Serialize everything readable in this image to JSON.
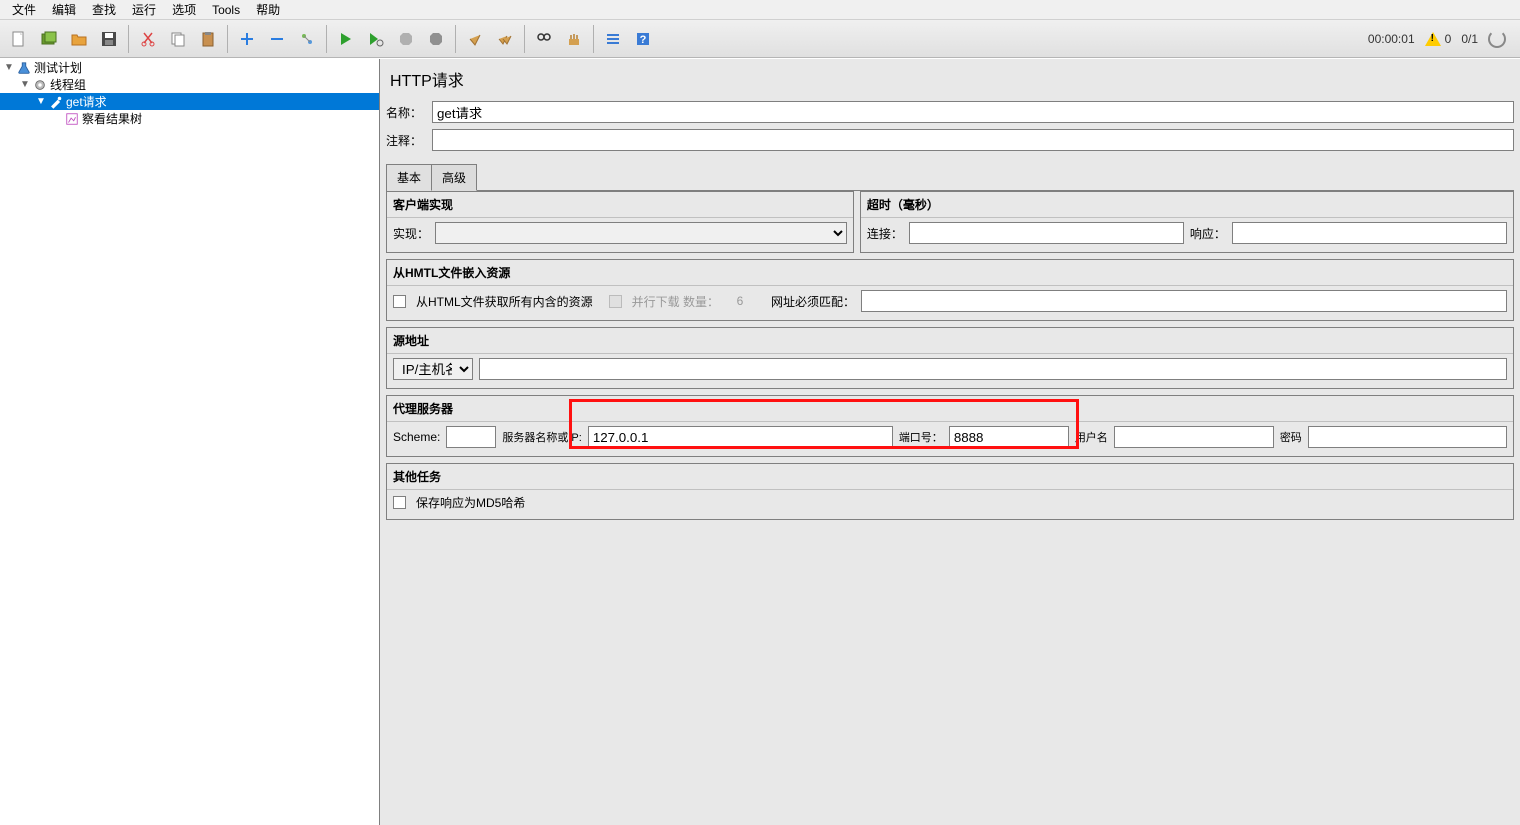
{
  "menu": {
    "file": "文件",
    "edit": "编辑",
    "search": "查找",
    "run": "运行",
    "options": "选项",
    "tools": "Tools",
    "help": "帮助"
  },
  "status": {
    "time": "00:00:01",
    "warn_count": "0",
    "threads": "0/1"
  },
  "tree": {
    "root": "测试计划",
    "group": "线程组",
    "req": "get请求",
    "result": "察看结果树"
  },
  "page": {
    "title": "HTTP请求"
  },
  "form": {
    "name_label": "名称：",
    "name_value": "get请求",
    "comment_label": "注释：",
    "comment_value": ""
  },
  "tabs": {
    "basic": "基本",
    "advanced": "高级"
  },
  "client_impl": {
    "header": "客户端实现",
    "label": "实现：",
    "value": ""
  },
  "timeout": {
    "header": "超时（毫秒）",
    "connect_label": "连接：",
    "connect_value": "",
    "response_label": "响应：",
    "response_value": ""
  },
  "embed": {
    "header": "从HMTL文件嵌入资源",
    "check_label": "从HTML文件获取所有内含的资源",
    "parallel_label": "并行下载 数量：",
    "parallel_value": "6",
    "url_match_label": "网址必须匹配：",
    "url_match_value": ""
  },
  "source": {
    "header": "源地址",
    "dropdown": "IP/主机名",
    "value": ""
  },
  "proxy": {
    "header": "代理服务器",
    "scheme_label": "Scheme:",
    "scheme_value": "",
    "server_label": "服务器名称或IP:",
    "server_value": "127.0.0.1",
    "port_label": "端口号：",
    "port_value": "8888",
    "user_label": "用户名",
    "user_value": "",
    "pass_label": "密码",
    "pass_value": ""
  },
  "other": {
    "header": "其他任务",
    "md5_label": "保存响应为MD5哈希"
  }
}
